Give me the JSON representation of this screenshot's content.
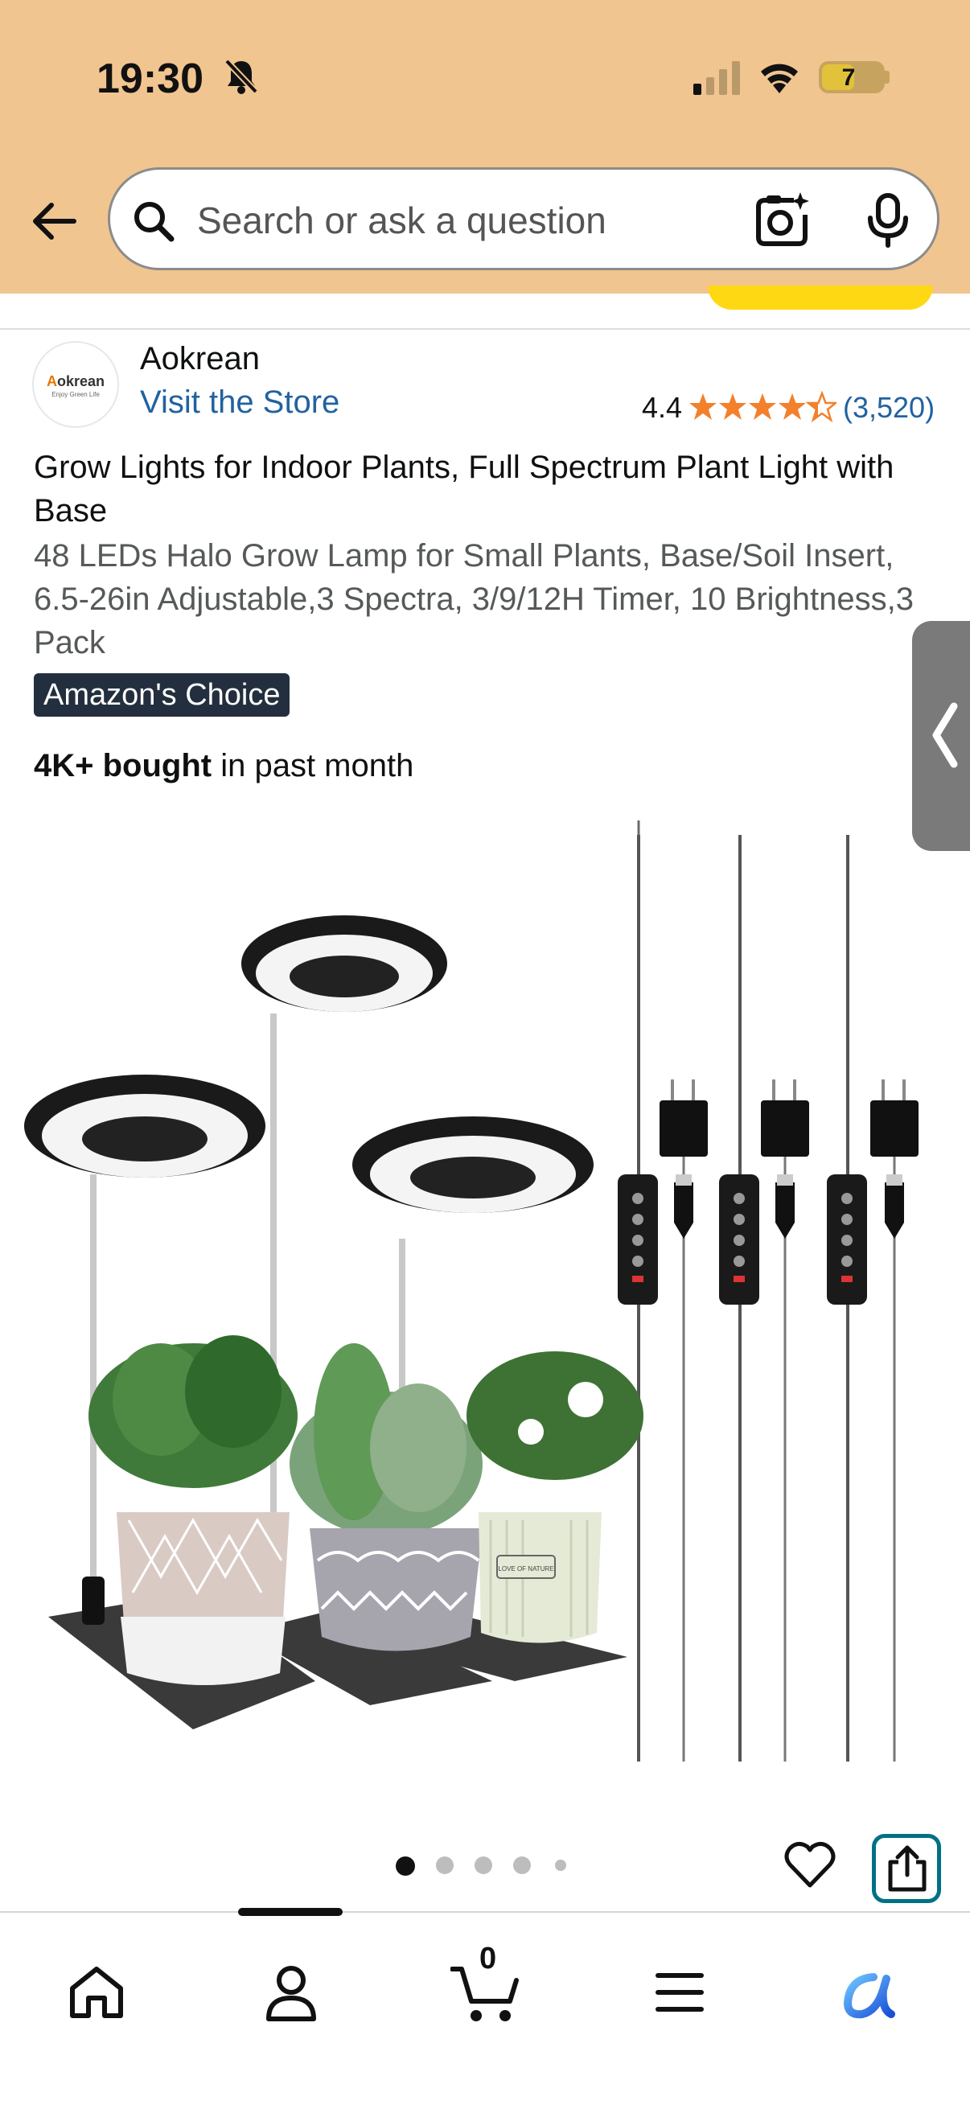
{
  "status_bar": {
    "time": "19:30",
    "battery": "7"
  },
  "search": {
    "placeholder": "Search or ask a question"
  },
  "brand": {
    "logo_text_a": "A",
    "logo_text_rest": "okrean",
    "logo_tagline": "Enjoy Green Life",
    "name": "Aokrean",
    "visit_store": "Visit the Store"
  },
  "rating": {
    "value": "4.4",
    "stars": 4.4,
    "count": "(3,520)"
  },
  "product": {
    "title": "Grow Lights for Indoor Plants, Full Spectrum Plant Light with Base",
    "subtitle": "48 LEDs Halo Grow Lamp for Small Plants, Base/Soil Insert, 6.5-26in Adjustable,3 Spectra, 3/9/12H Timer, 10 Brightness,3 Pack",
    "badge": "Amazon's Choice",
    "bought_bold": "4K+ bought",
    "bought_rest": " in past month",
    "pot_label": "LOVE OF NATURE"
  },
  "gallery": {
    "current_index": 1,
    "total_dots": 5
  },
  "bottom_nav": {
    "cart_count": "0",
    "items": [
      "home-icon",
      "account-icon",
      "cart-icon",
      "menu-icon",
      "rufus-icon"
    ]
  },
  "colors": {
    "header": "#f1c590",
    "link": "#2162a1",
    "star": "#f3802b",
    "badge": "#232f3e",
    "share_border": "#007185"
  }
}
